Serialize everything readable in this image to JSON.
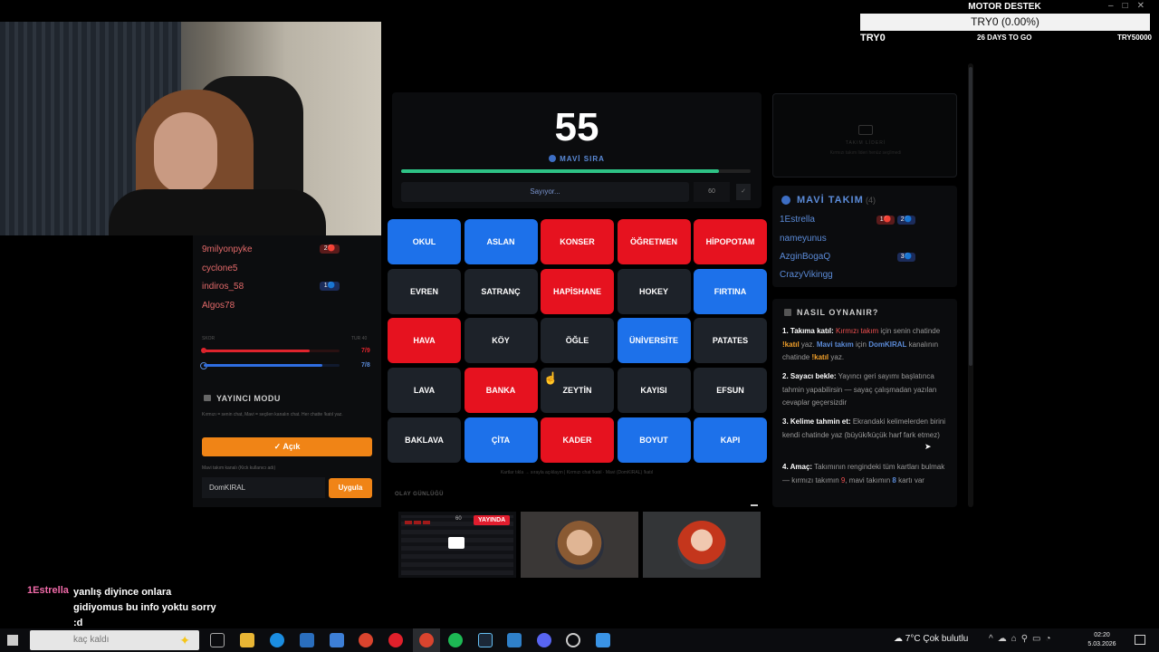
{
  "goal": {
    "title": "MOTOR DESTEK",
    "progress_text": "TRY0 (0.00%)",
    "progress": 0.0,
    "current": "TRY0",
    "days_left": "26 DAYS TO GO",
    "target": "TRY50000"
  },
  "left_panel": {
    "players": [
      {
        "name": "9milyonpyke",
        "badge": "2🔴"
      },
      {
        "name": "cyclone5",
        "badge": ""
      },
      {
        "name": "indiros_58",
        "badge": "1🔵"
      },
      {
        "name": "Algos78",
        "badge": ""
      }
    ],
    "score_label": "SKOR",
    "turn_label": "TUR 40",
    "red_score": "7/9",
    "blue_score": "7/8",
    "red_progress": 0.78,
    "blue_progress": 0.875,
    "streamer_mode_title": "YAYINCI MODU",
    "streamer_mode_desc": "Kırmızı = senin chat, Mavi = seçilen kanalın chat. Her chatte !katıl yaz.",
    "toggle_label": "✓ Açık",
    "channel_label": "Mavi takım kanalı (Kick kullanıcı adı)",
    "channel_value": "DomKIRAL",
    "apply_label": "Uygula"
  },
  "game": {
    "timer": "55",
    "turn": "MAVİ SIRA",
    "turn_progress": 0.91,
    "counting": "Sayıyor...",
    "seconds": "60",
    "set_button": "✓",
    "legend": "Kartlar tıkla → sırayla açıklayın | Kırmızı chat !katıl · Mavi (DomKIRAL) !katıl",
    "event_log_title": "OLAY GÜNLÜĞÜ",
    "cards": [
      {
        "word": "OKUL",
        "color": "blue"
      },
      {
        "word": "ASLAN",
        "color": "blue"
      },
      {
        "word": "KONSER",
        "color": "red"
      },
      {
        "word": "ÖĞRETMEN",
        "color": "red"
      },
      {
        "word": "HİPOPOTAM",
        "color": "red"
      },
      {
        "word": "EVREN",
        "color": "neutral"
      },
      {
        "word": "SATRANÇ",
        "color": "neutral"
      },
      {
        "word": "HAPİSHANE",
        "color": "red"
      },
      {
        "word": "HOKEY",
        "color": "neutral"
      },
      {
        "word": "FIRTINA",
        "color": "blue"
      },
      {
        "word": "HAVA",
        "color": "red"
      },
      {
        "word": "KÖY",
        "color": "neutral"
      },
      {
        "word": "ÖĞLE",
        "color": "neutral"
      },
      {
        "word": "ÜNİVERSİTE",
        "color": "blue"
      },
      {
        "word": "PATATES",
        "color": "neutral"
      },
      {
        "word": "LAVA",
        "color": "neutral"
      },
      {
        "word": "BANKA",
        "color": "red"
      },
      {
        "word": "ZEYTİN",
        "color": "neutral"
      },
      {
        "word": "KAYISI",
        "color": "neutral"
      },
      {
        "word": "EFSUN",
        "color": "neutral"
      },
      {
        "word": "BAKLAVA",
        "color": "neutral"
      },
      {
        "word": "ÇİTA",
        "color": "blue"
      },
      {
        "word": "KADER",
        "color": "red"
      },
      {
        "word": "BOYUT",
        "color": "blue"
      },
      {
        "word": "KAPI",
        "color": "blue"
      }
    ]
  },
  "participants": {
    "live_badge": "YAYINDA",
    "live_count": "60"
  },
  "right_panel": {
    "leader_title": "TAKIM LİDERİ",
    "leader_desc": "Kırmızı takım lideri henüz seçilmedi",
    "team_title": "MAVİ TAKIM",
    "team_count": "(4)",
    "members": [
      {
        "name": "1Estrella",
        "badges": [
          "1🔴",
          "2🔵"
        ]
      },
      {
        "name": "nameyunus",
        "badges": []
      },
      {
        "name": "AzginBogaQ",
        "badges": [
          "3🔵"
        ]
      },
      {
        "name": "CrazyVikingg",
        "badges": []
      }
    ],
    "howto_title": "NASIL OYNANIR?",
    "steps": {
      "s1_head": "1. Takıma katıl:",
      "s1_red": "Kırmızı takım",
      "s1_a": "için senin chatinde",
      "s1_cmd1": "!katıl",
      "s1_b": "yaz.",
      "s1_blue": "Mavi takım",
      "s1_c": "için",
      "s1_chan": "DomKIRAL",
      "s1_d": "kanalının chatinde",
      "s1_cmd2": "!katıl",
      "s1_e": "yaz.",
      "s2_head": "2. Sayacı bekle:",
      "s2_text": "Yayıncı geri sayımı başlatınca tahmin yapabilirsin — sayaç çalışmadan yazılan cevaplar geçersizdir",
      "s3_head": "3. Kelime tahmin et:",
      "s3_text": "Ekrandaki kelimelerden birini kendi chatinde yaz (büyük/küçük harf fark etmez)",
      "s4_head": "4. Amaç:",
      "s4_a": "Takımının rengindeki tüm kartları bulmak — kırmızı takımın",
      "s4_n1": "9",
      "s4_b": ", mavi takımın",
      "s4_n2": "8",
      "s4_c": "kartı var"
    }
  },
  "chat": {
    "user": "1Estrella",
    "message": "yanlış diyince onlara gidiyomus bu info yoktu sorry :d"
  },
  "taskbar": {
    "search_placeholder": "kaç kaldı",
    "weather": "7°C  Çok bulutlu",
    "time": "02:20",
    "date": "5.03.2026"
  },
  "colors": {
    "blue_card": "#1d71ea",
    "red_card": "#e6121f",
    "neutral_card": "#1d2229",
    "accent_orange": "#f08416",
    "progress_green": "#2ec285"
  }
}
